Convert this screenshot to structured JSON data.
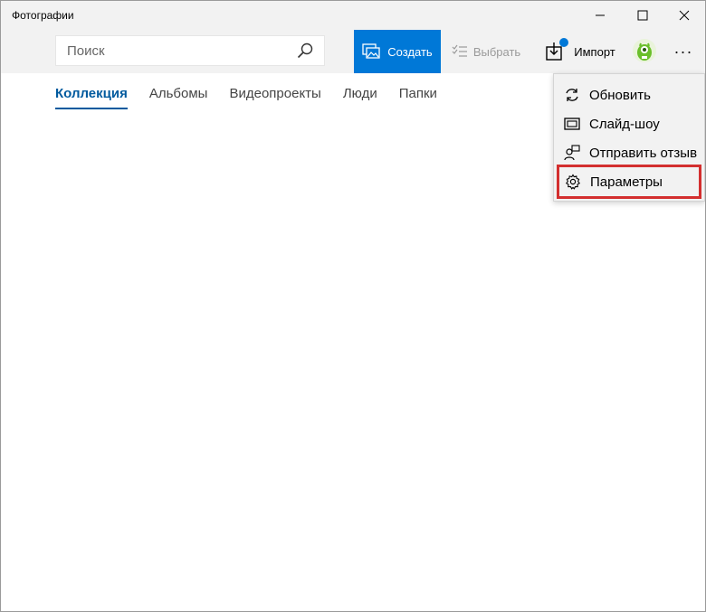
{
  "window": {
    "title": "Фотографии"
  },
  "window_controls": {
    "minimize": "—",
    "maximize": "☐",
    "close": "✕"
  },
  "search": {
    "placeholder": "Поиск",
    "value": ""
  },
  "toolbar": {
    "create_label": "Создать",
    "select_label": "Выбрать",
    "import_label": "Импорт",
    "more_label": "···"
  },
  "tabs": [
    {
      "label": "Коллекция",
      "active": true
    },
    {
      "label": "Альбомы",
      "active": false
    },
    {
      "label": "Видеопроекты",
      "active": false
    },
    {
      "label": "Люди",
      "active": false
    },
    {
      "label": "Папки",
      "active": false
    }
  ],
  "menu": {
    "items": [
      {
        "label": "Обновить",
        "icon": "refresh-icon"
      },
      {
        "label": "Слайд-шоу",
        "icon": "slideshow-icon"
      },
      {
        "label": "Отправить отзыв",
        "icon": "feedback-icon"
      },
      {
        "label": "Параметры",
        "icon": "gear-icon",
        "highlighted": true
      }
    ]
  },
  "colors": {
    "accent": "#0078d7",
    "highlight_border": "#d32f2f",
    "active_tab": "#005a9e"
  }
}
